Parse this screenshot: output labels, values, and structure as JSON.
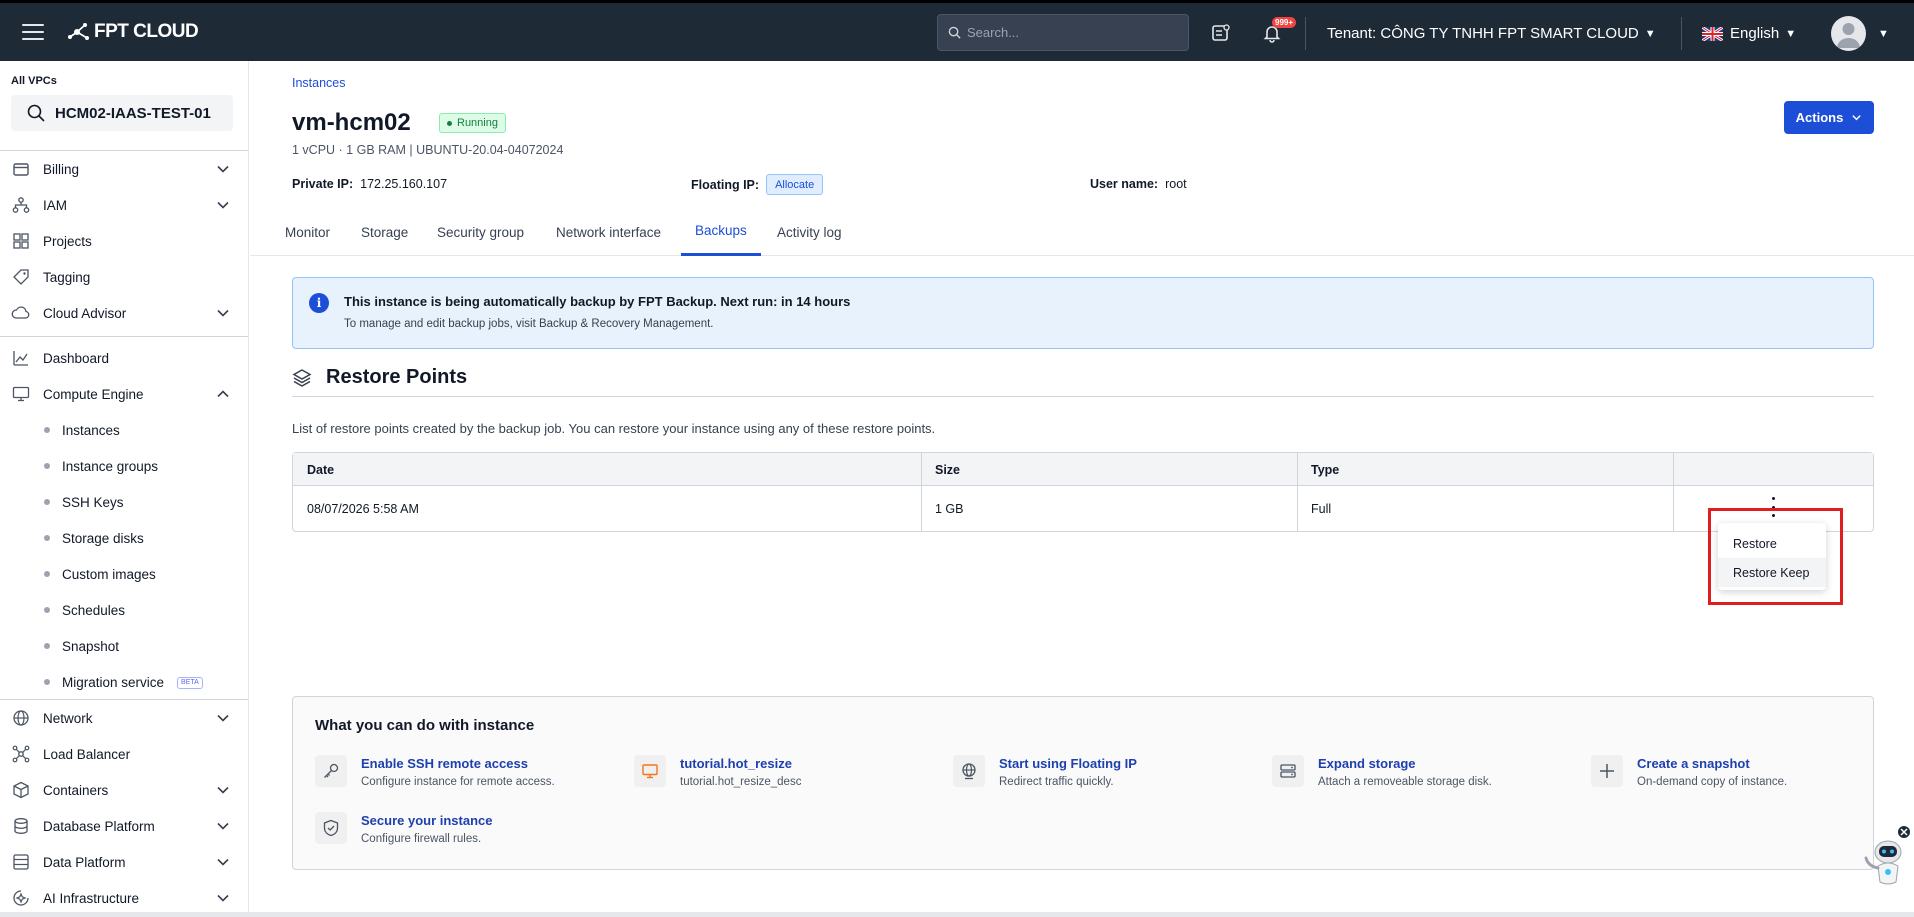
{
  "topbar": {
    "logo_text": "FPT CLOUD",
    "search_placeholder": "Search...",
    "notification_badge": "999+",
    "tenant_label": "Tenant:",
    "tenant_name": "CÔNG TY TNHH FPT SMART CLOUD",
    "language": "English"
  },
  "sidebar": {
    "vpc_label": "All VPCs",
    "vpc_selected": "HCM02-IAAS-TEST-01",
    "items": [
      {
        "label": "Billing",
        "icon": "billing-icon",
        "expandable": true
      },
      {
        "label": "IAM",
        "icon": "iam-icon",
        "expandable": true
      },
      {
        "label": "Projects",
        "icon": "projects-icon",
        "expandable": false
      },
      {
        "label": "Tagging",
        "icon": "tag-icon",
        "expandable": false
      },
      {
        "label": "Cloud Advisor",
        "icon": "cloud-icon",
        "expandable": true
      },
      {
        "label": "Dashboard",
        "icon": "dashboard-icon",
        "expandable": false
      },
      {
        "label": "Compute Engine",
        "icon": "monitor-icon",
        "expandable": true,
        "expanded": true
      }
    ],
    "compute_sub": [
      {
        "label": "Instances"
      },
      {
        "label": "Instance groups"
      },
      {
        "label": "SSH Keys"
      },
      {
        "label": "Storage disks"
      },
      {
        "label": "Custom images"
      },
      {
        "label": "Schedules"
      },
      {
        "label": "Snapshot"
      },
      {
        "label": "Migration service",
        "badge": "BETA"
      }
    ],
    "items_after": [
      {
        "label": "Network",
        "icon": "globe-icon",
        "expandable": true
      },
      {
        "label": "Load Balancer",
        "icon": "load-balancer-icon",
        "expandable": false
      },
      {
        "label": "Containers",
        "icon": "cube-icon",
        "expandable": true
      },
      {
        "label": "Database Platform",
        "icon": "database-icon",
        "expandable": true
      },
      {
        "label": "Data Platform",
        "icon": "data-platform-icon",
        "expandable": true
      },
      {
        "label": "AI Infrastructure",
        "icon": "ai-icon",
        "expandable": true
      }
    ]
  },
  "main": {
    "breadcrumb": "Instances",
    "title": "vm-hcm02",
    "status": "Running",
    "specs": "1 vCPU · 1 GB RAM | UBUNTU-20.04-04072024",
    "private_ip_label": "Private IP:",
    "private_ip": "172.25.160.107",
    "floating_ip_label": "Floating IP:",
    "floating_ip_action": "Allocate",
    "username_label": "User name:",
    "username": "root",
    "actions_label": "Actions",
    "tabs": [
      {
        "label": "Monitor"
      },
      {
        "label": "Storage"
      },
      {
        "label": "Security group"
      },
      {
        "label": "Network interface"
      },
      {
        "label": "Backups",
        "active": true
      },
      {
        "label": "Activity log"
      }
    ],
    "info": {
      "title": "This instance is being automatically backup by FPT Backup. Next run: in 14 hours",
      "subtitle": "To manage and edit backup jobs, visit Backup & Recovery Management."
    },
    "restore": {
      "heading": "Restore Points",
      "description": "List of restore points created by the backup job. You can restore your instance using any of these restore points.",
      "columns": [
        "Date",
        "Size",
        "Type"
      ],
      "rows": [
        {
          "date": "08/07/2026 5:58 AM",
          "size": "1 GB",
          "type": "Full"
        }
      ],
      "menu": [
        "Restore",
        "Restore Keep"
      ]
    },
    "todo": {
      "title": "What you can do with instance",
      "items": [
        {
          "name": "Enable SSH remote access",
          "desc": "Configure instance for remote access.",
          "icon": "key-icon"
        },
        {
          "name": "tutorial.hot_resize",
          "desc": "tutorial.hot_resize_desc",
          "icon": "monitor-icon"
        },
        {
          "name": "Start using Floating IP",
          "desc": "Redirect traffic quickly.",
          "icon": "globe-icon"
        },
        {
          "name": "Expand storage",
          "desc": "Attach a removeable storage disk.",
          "icon": "storage-icon"
        },
        {
          "name": "Create a snapshot",
          "desc": "On-demand copy of instance.",
          "icon": "plus-icon"
        },
        {
          "name": "Secure your instance",
          "desc": "Configure firewall rules.",
          "icon": "shield-icon"
        }
      ]
    }
  },
  "colors": {
    "topbar_bg": "#1f2a37",
    "accent": "#1d4ed8",
    "running": "#15803d",
    "highlight": "#e11d1d"
  }
}
